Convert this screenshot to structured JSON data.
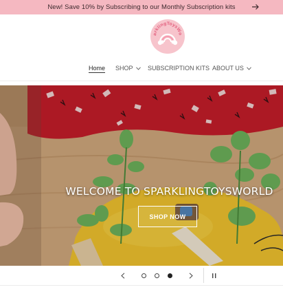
{
  "announcement": {
    "text": "New! Save 10% by Subscribing to our Monthly Subscription kits",
    "arrow_icon": "arrow-right-icon"
  },
  "logo": {
    "text": "SparklingToysWorld",
    "colors": {
      "circle": "#f7c4cc",
      "text": "#e56a86"
    }
  },
  "nav": {
    "items": [
      {
        "label": "Home",
        "active": true
      },
      {
        "label": "SHOP",
        "dropdown": true
      },
      {
        "label": "SUBSCRIPTION KITS"
      },
      {
        "label": "ABOUT US",
        "dropdown": true
      }
    ]
  },
  "hero": {
    "title": "WELCOME TO SPARKLINGTOYSWORLD",
    "button_label": "SHOP NOW"
  },
  "slider": {
    "slide_count": 3,
    "active_index": 3,
    "prev_icon": "chevron-left-icon",
    "next_icon": "chevron-right-icon",
    "pause_icon": "pause-icon"
  },
  "colors": {
    "announcement_bg": "#f5b8c1",
    "hero_overlay_text": "#ffffff"
  }
}
